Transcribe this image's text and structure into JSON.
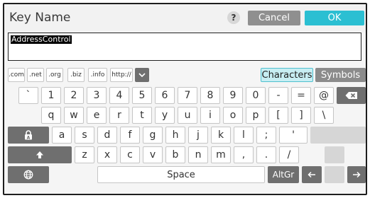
{
  "dialog": {
    "title": "Key Name",
    "help_label": "?",
    "cancel_label": "Cancel",
    "ok_label": "OK"
  },
  "input": {
    "value": "AddressControl"
  },
  "domain_row": {
    "keys": [
      ".com",
      ".net",
      ".org",
      ".biz",
      ".info",
      "http://"
    ],
    "characters_label": "Characters",
    "symbols_label": "Symbols"
  },
  "row1": [
    "`",
    "1",
    "2",
    "3",
    "4",
    "5",
    "6",
    "7",
    "8",
    "9",
    "0",
    "-",
    "=",
    "@"
  ],
  "row2": [
    "q",
    "w",
    "e",
    "r",
    "t",
    "y",
    "u",
    "i",
    "o",
    "p",
    "[",
    "]",
    "\\"
  ],
  "row3": [
    "a",
    "s",
    "d",
    "f",
    "g",
    "h",
    "j",
    "k",
    "l",
    ";",
    "'"
  ],
  "row4": [
    "z",
    "x",
    "c",
    "v",
    "b",
    "n",
    "m",
    ",",
    ".",
    "/"
  ],
  "bottom": {
    "space_label": "Space",
    "altgr_label": "AltGr"
  },
  "icons": [
    "help-icon",
    "chevron-down-icon",
    "backspace-icon",
    "lock-icon",
    "shift-icon",
    "globe-icon",
    "arrow-left-icon",
    "arrow-right-icon"
  ]
}
